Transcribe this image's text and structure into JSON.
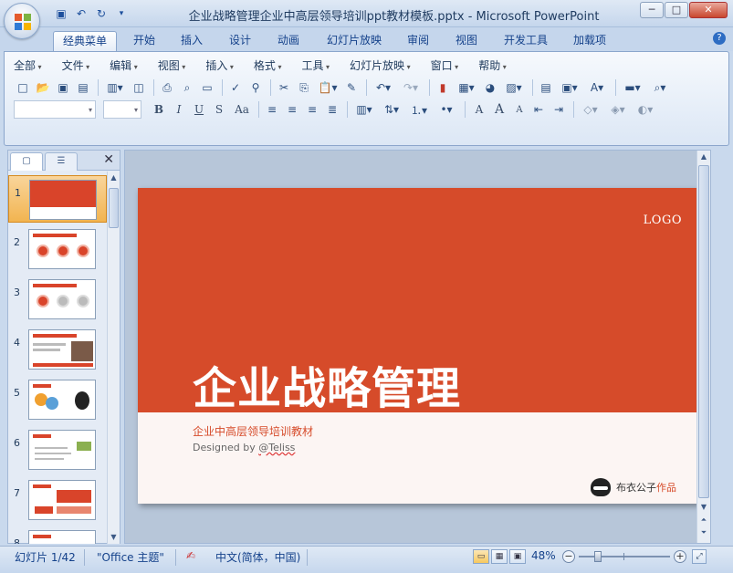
{
  "window": {
    "title": "企业战略管理企业中高层领导培训ppt教材模板.pptx - Microsoft PowerPoint",
    "controls": {
      "minimize": "─",
      "maximize": "□",
      "close": "✕"
    }
  },
  "quick_access": [
    {
      "name": "save-icon",
      "glyph": "💾"
    },
    {
      "name": "undo-icon",
      "glyph": "↶"
    },
    {
      "name": "redo-icon",
      "glyph": "↻"
    },
    {
      "name": "customize-icon",
      "glyph": "▾"
    }
  ],
  "ribbon_tabs": [
    {
      "label": "经典菜单",
      "active": true
    },
    {
      "label": "开始"
    },
    {
      "label": "插入"
    },
    {
      "label": "设计"
    },
    {
      "label": "动画"
    },
    {
      "label": "幻灯片放映"
    },
    {
      "label": "审阅"
    },
    {
      "label": "视图"
    },
    {
      "label": "开发工具"
    },
    {
      "label": "加载项"
    }
  ],
  "help_glyph": "?",
  "classic_menu": [
    "全部",
    "文件",
    "编辑",
    "视图",
    "插入",
    "格式",
    "工具",
    "幻灯片放映",
    "窗口",
    "帮助"
  ],
  "format_buttons": {
    "bold": "B",
    "italic": "I",
    "underline": "U",
    "shadow": "S",
    "case": "Aa",
    "font_grow": "A",
    "font_shrink": "A"
  },
  "panel": {
    "tab_slides_glyph": "▢",
    "tab_outline_glyph": "☰",
    "close_glyph": "✕",
    "thumbnails": [
      {
        "num": "1",
        "selected": true,
        "style": "title"
      },
      {
        "num": "2",
        "style": "circles-red"
      },
      {
        "num": "3",
        "style": "circles-gray"
      },
      {
        "num": "4",
        "style": "photo"
      },
      {
        "num": "5",
        "style": "icons"
      },
      {
        "num": "6",
        "style": "text"
      },
      {
        "num": "7",
        "style": "boxes"
      },
      {
        "num": "8",
        "style": "text"
      }
    ]
  },
  "slide": {
    "logo": "LOGO",
    "title": "企业战略管理",
    "subtitle": "企业中高层领导培训教材",
    "designed_by": "Designed by ",
    "handle": "@Teliss",
    "author_name": "布衣公子",
    "author_suffix": "作品",
    "colors": {
      "brand": "#d64b2a",
      "background": "#fcf5f3"
    }
  },
  "status": {
    "slide_info": "幻灯片 1/42",
    "theme": "\"Office 主题\"",
    "language": "中文(简体，中国)",
    "zoom": "48%",
    "zoom_value": 48
  }
}
